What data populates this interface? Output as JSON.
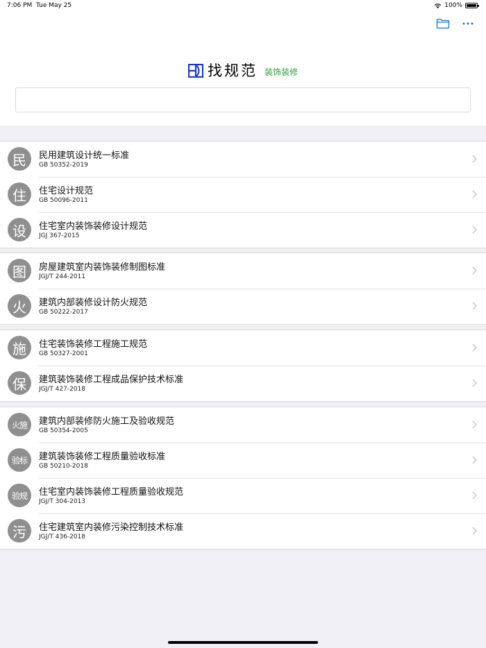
{
  "status": {
    "time": "7:06 PM",
    "date": "Tue May 25",
    "battery": "100%",
    "battery_level": 1.0
  },
  "toolbar": {
    "folder_icon": "folder-icon",
    "more_icon": "ellipsis-icon"
  },
  "brand": {
    "title": "找规范",
    "subtitle": "装饰装修",
    "accent": "#2e9c3a",
    "logo_color": "#1a35d6"
  },
  "search": {
    "value": "",
    "placeholder": ""
  },
  "groups": [
    {
      "items": [
        {
          "icon": "民",
          "title": "民用建筑设计统一标准",
          "code": "GB 50352-2019"
        },
        {
          "icon": "住",
          "title": "住宅设计规范",
          "code": "GB 50096-2011"
        },
        {
          "icon": "设",
          "title": "住宅室内装饰装修设计规范",
          "code": "JGJ 367-2015"
        }
      ]
    },
    {
      "items": [
        {
          "icon": "图",
          "title": "房屋建筑室内装饰装修制图标准",
          "code": "JGJ/T 244-2011"
        },
        {
          "icon": "火",
          "title": "建筑内部装修设计防火规范",
          "code": "GB 50222-2017"
        }
      ]
    },
    {
      "items": [
        {
          "icon": "施",
          "title": "住宅装饰装修工程施工规范",
          "code": "GB 50327-2001"
        },
        {
          "icon": "保",
          "title": "建筑装饰装修工程成品保护技术标准",
          "code": "JGJ/T 427-2018"
        }
      ]
    },
    {
      "items": [
        {
          "icon": "火施",
          "title": "建筑内部装修防火施工及验收规范",
          "code": "GB 50354-2005"
        },
        {
          "icon": "验标",
          "title": "建筑装饰装修工程质量验收标准",
          "code": "GB 50210-2018"
        },
        {
          "icon": "验规",
          "title": "住宅室内装饰装修工程质量验收规范",
          "code": "JGJ/T 304-2013"
        },
        {
          "icon": "污",
          "title": "住宅建筑室内装修污染控制技术标准",
          "code": "JGJ/T 436-2018"
        }
      ]
    }
  ]
}
